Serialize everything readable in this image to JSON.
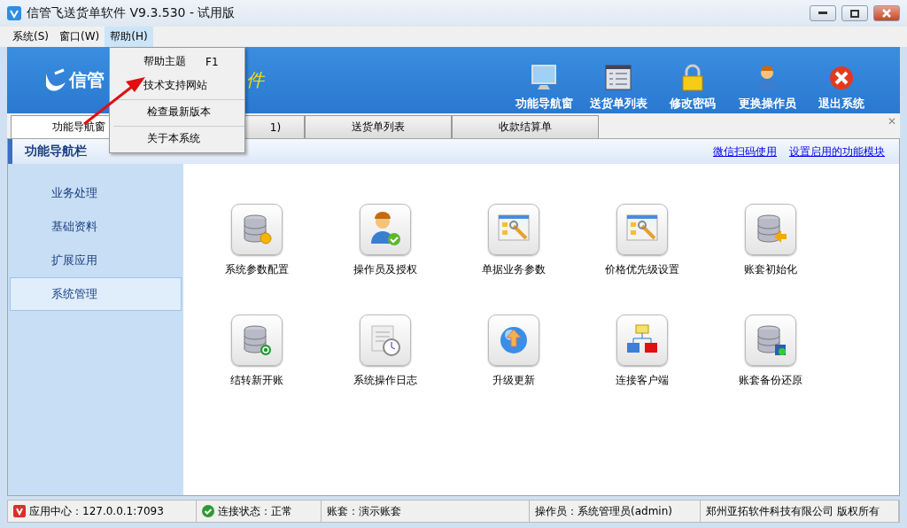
{
  "window": {
    "title": "信管飞送货单软件 V9.3.530 - 试用版"
  },
  "menu_bar": [
    {
      "label": "系统(S)",
      "selected": false
    },
    {
      "label": "窗口(W)",
      "selected": false
    },
    {
      "label": "帮助(H)",
      "selected": true
    }
  ],
  "menu": {
    "items": [
      {
        "label": "帮助主题",
        "shortcut": "F1",
        "separator_before": false
      },
      {
        "label": "技术支持网站",
        "separator_before": false
      },
      {
        "label": "检查最新版本",
        "separator_before": true
      },
      {
        "label": "关于本系统",
        "separator_before": true
      }
    ]
  },
  "banner": {
    "title": "信管",
    "title_tail": "件"
  },
  "toolbar": [
    {
      "label": "功能导航窗",
      "kind": "monitor"
    },
    {
      "label": "送货单列表",
      "kind": "list"
    },
    {
      "label": "修改密码",
      "kind": "lock"
    },
    {
      "label": "更换操作员",
      "kind": "user"
    },
    {
      "label": "退出系统",
      "kind": "exit"
    }
  ],
  "tabs": [
    {
      "label": "功能导航窗",
      "selected": true
    },
    {
      "label": "1)",
      "selected": false
    },
    {
      "label": "送货单列表",
      "selected": false
    },
    {
      "label": "收款结算单",
      "selected": false
    }
  ],
  "tab_close": "✕",
  "panel_header": {
    "title": "功能导航栏",
    "links": [
      "微信扫码使用",
      "设置启用的功能模块"
    ]
  },
  "sidebar": {
    "items": [
      {
        "label": "业务处理",
        "selected": false
      },
      {
        "label": "基础资料",
        "selected": false
      },
      {
        "label": "扩展应用",
        "selected": false
      },
      {
        "label": "系统管理",
        "selected": true
      }
    ]
  },
  "functions": [
    {
      "label": "系统参数配置",
      "kind": "db-gear"
    },
    {
      "label": "操作员及授权",
      "kind": "user-check"
    },
    {
      "label": "单据业务参数",
      "kind": "checklist"
    },
    {
      "label": "价格优先级设置",
      "kind": "checklist"
    },
    {
      "label": "账套初始化",
      "kind": "db-arrow"
    },
    {
      "label": "结转新开账",
      "kind": "db-refresh"
    },
    {
      "label": "系统操作日志",
      "kind": "log"
    },
    {
      "label": "升级更新",
      "kind": "globe"
    },
    {
      "label": "连接客户端",
      "kind": "network"
    },
    {
      "label": "账套备份还原",
      "kind": "db-save"
    }
  ],
  "status_bar": [
    {
      "text": "应用中心：127.0.0.1:7093",
      "kind": "app"
    },
    {
      "text": "连接状态：正常",
      "kind": "ok"
    },
    {
      "text": "账套：演示账套",
      "kind": "plain"
    },
    {
      "text": "操作员：系统管理员(admin)",
      "kind": "plain"
    },
    {
      "text": "郑州亚拓软件科技有限公司 版权所有",
      "kind": "plain"
    }
  ]
}
